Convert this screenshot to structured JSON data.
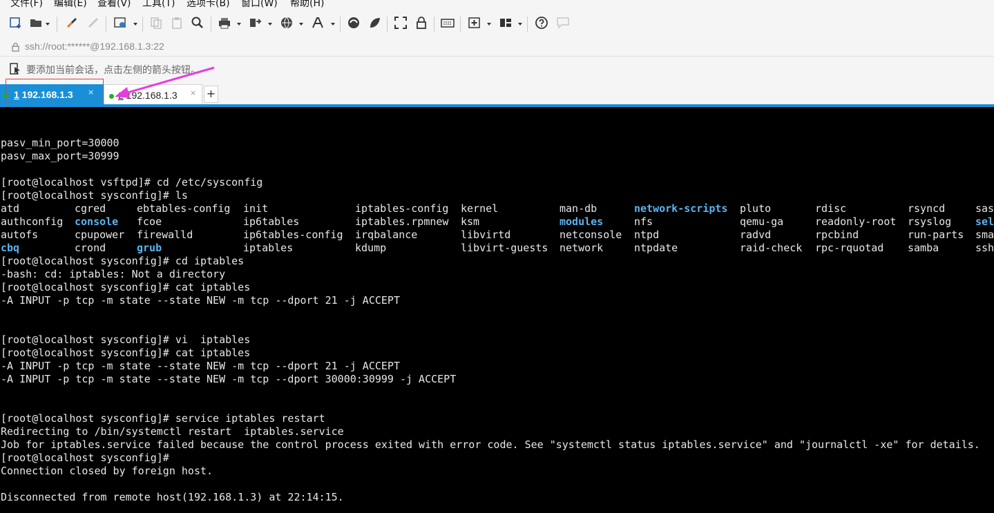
{
  "menubar": {
    "items": [
      "文件(F)",
      "编辑(E)",
      "查看(V)",
      "工具(T)",
      "选项卡(B)",
      "窗口(W)",
      "帮助(H)"
    ]
  },
  "toolbar": {
    "icons": [
      "new-session-icon",
      "open-folder-icon",
      "connect-icon",
      "disconnect-icon",
      "properties-icon",
      "copy-icon",
      "paste-icon",
      "find-icon",
      "print-icon",
      "transfer-icon",
      "globe-icon",
      "font-icon",
      "xftp-icon",
      "xshell-icon",
      "fullscreen-icon",
      "lock-icon",
      "keyboard-icon",
      "compose-icon",
      "layout-icon",
      "help-icon",
      "chat-icon"
    ]
  },
  "address": {
    "url": "ssh://root:******@192.168.1.3:22"
  },
  "session_hint": {
    "text": "要添加当前会话，点击左侧的箭头按钮。"
  },
  "tabs": [
    {
      "num": "1",
      "label": " 192.168.1.3",
      "close": "×",
      "status_color": "#21b021"
    },
    {
      "num": "2",
      "label": " 192.168.1.3",
      "close": "×",
      "status_color": "#21b021"
    }
  ],
  "new_tab": "+",
  "terminal": {
    "lines_top": [
      "pasv_min_port=30000",
      "pasv_max_port=30999",
      "",
      "[root@localhost vsftpd]# cd /etc/sysconfig",
      "[root@localhost sysconfig]# ls"
    ],
    "ls_rows": [
      [
        "atd",
        "cgred",
        "ebtables-config",
        "init",
        "iptables-config",
        "kernel",
        "man-db",
        "network-scripts",
        "pluto",
        "rdisc",
        "rsyncd",
        "sas"
      ],
      [
        "authconfig",
        "console",
        "fcoe",
        "ip6tables",
        "iptables.rpmnew",
        "ksm",
        "modules",
        "nfs",
        "qemu-ga",
        "readonly-root",
        "rsyslog",
        "sel"
      ],
      [
        "autofs",
        "cpupower",
        "firewalld",
        "ip6tables-config",
        "irqbalance",
        "libvirtd",
        "netconsole",
        "ntpd",
        "radvd",
        "rpcbind",
        "run-parts",
        "sma"
      ],
      [
        "cbq",
        "crond",
        "grub",
        "iptables",
        "kdump",
        "libvirt-guests",
        "network",
        "ntpdate",
        "raid-check",
        "rpc-rquotad",
        "samba",
        "ssh"
      ]
    ],
    "ls_dirs": [
      "network-scripts",
      "console",
      "modules",
      "sel",
      "cbq",
      "grub"
    ],
    "lines_bottom": [
      "[root@localhost sysconfig]# cd iptables",
      "-bash: cd: iptables: Not a directory",
      "[root@localhost sysconfig]# cat iptables",
      "-A INPUT -p tcp -m state --state NEW -m tcp --dport 21 -j ACCEPT",
      "",
      "",
      "[root@localhost sysconfig]# vi  iptables",
      "[root@localhost sysconfig]# cat iptables",
      "-A INPUT -p tcp -m state --state NEW -m tcp --dport 21 -j ACCEPT",
      "-A INPUT -p tcp -m state --state NEW -m tcp --dport 30000:30999 -j ACCEPT",
      "",
      "",
      "[root@localhost sysconfig]# service iptables restart",
      "Redirecting to /bin/systemctl restart  iptables.service",
      "Job for iptables.service failed because the control process exited with error code. See \"systemctl status iptables.service\" and \"journalctl -xe\" for details.",
      "[root@localhost sysconfig]#",
      "Connection closed by foreign host.",
      "",
      "Disconnected from remote host(192.168.1.3) at 22:14:15."
    ]
  },
  "colors": {
    "tab_active": "#1a8fd8",
    "directory": "#5ab4f0",
    "annotation_box": "#e23b3b",
    "annotation_arrow": "#e63ce0"
  }
}
